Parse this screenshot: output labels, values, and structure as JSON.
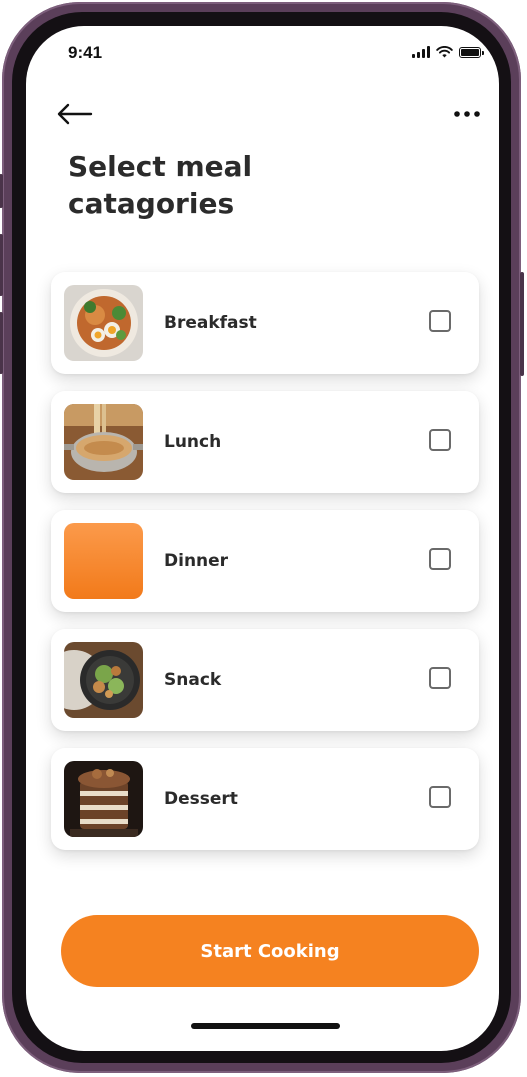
{
  "status_bar": {
    "time": "9:41",
    "icons": [
      "signal-icon",
      "wifi-icon",
      "battery-icon"
    ]
  },
  "header": {
    "back_icon": "arrow-left-icon",
    "menu_icon": "more-horizontal-icon",
    "title": "Select meal catagories"
  },
  "categories": [
    {
      "label": "Breakfast",
      "image": "breakfast-bowl-image",
      "checked": false
    },
    {
      "label": "Lunch",
      "image": "lunch-noodle-pot-image",
      "checked": false
    },
    {
      "label": "Dinner",
      "image": "dinner-placeholder-image",
      "checked": false
    },
    {
      "label": "Snack",
      "image": "snack-plate-image",
      "checked": false
    },
    {
      "label": "Dessert",
      "image": "dessert-cake-image",
      "checked": false
    }
  ],
  "cta": {
    "label": "Start Cooking"
  },
  "colors": {
    "accent": "#f58220",
    "text": "#2b2b2b",
    "phone_frame": "#5b3f5a"
  }
}
